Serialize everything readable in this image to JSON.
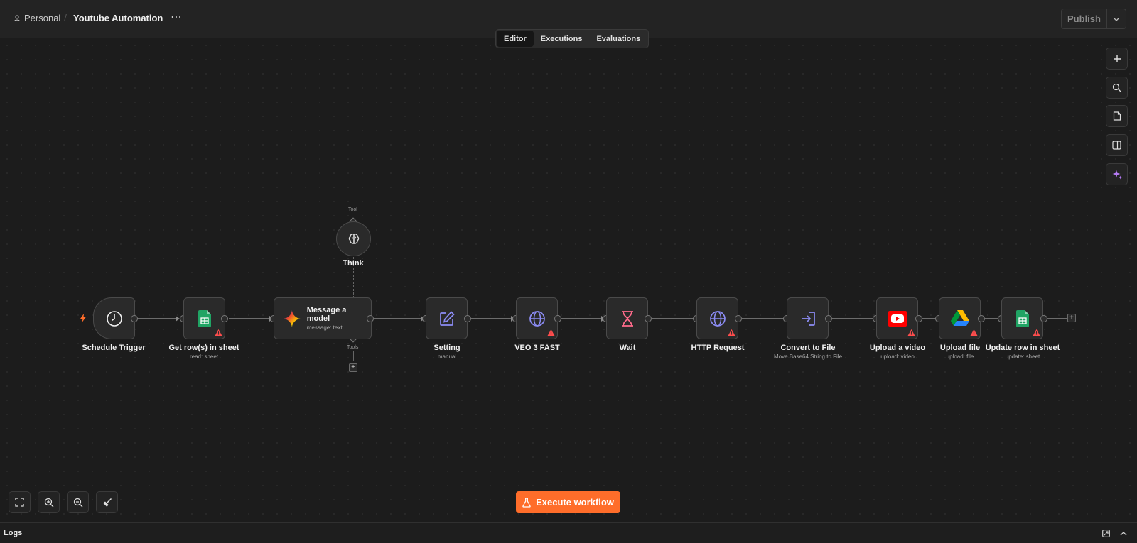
{
  "header": {
    "workspace": "Personal",
    "workflow_title": "Youtube Automation",
    "more": "⋯",
    "publish_label": "Publish"
  },
  "tabs": [
    {
      "label": "Editor",
      "active": true
    },
    {
      "label": "Executions",
      "active": false
    },
    {
      "label": "Evaluations",
      "active": false
    }
  ],
  "nodes": {
    "schedule": {
      "label": "Schedule Trigger",
      "icon": "clock-icon"
    },
    "getrows": {
      "label": "Get row(s) in sheet",
      "sub": "read: sheet",
      "icon": "google-sheets-icon",
      "warning": true
    },
    "message": {
      "label": "Message a model",
      "sub": "message: text",
      "icon": "gemini-icon"
    },
    "think": {
      "label": "Think",
      "icon": "brain-icon",
      "port_top": "Tool"
    },
    "tools_port": "Tools",
    "setting": {
      "label": "Setting",
      "sub": "manual",
      "icon": "edit-icon"
    },
    "veo": {
      "label": "VEO 3 FAST",
      "icon": "globe-icon",
      "warning": true
    },
    "wait": {
      "label": "Wait",
      "icon": "hourglass-icon"
    },
    "http": {
      "label": "HTTP Request",
      "icon": "globe-icon",
      "warning": true
    },
    "convert": {
      "label": "Convert to File",
      "sub": "Move Base64 String to File",
      "icon": "file-import-icon"
    },
    "upload_video": {
      "label": "Upload a video",
      "sub": "upload: video",
      "icon": "youtube-icon",
      "warning": true
    },
    "upload_file": {
      "label": "Upload file",
      "sub": "upload: file",
      "icon": "google-drive-icon",
      "warning": true
    },
    "update_row": {
      "label": "Update row in sheet",
      "sub": "update: sheet",
      "icon": "google-sheets-icon",
      "warning": true
    }
  },
  "actions": {
    "execute_label": "Execute workflow"
  },
  "logs": {
    "label": "Logs"
  },
  "colors": {
    "accent": "#ff6d2a",
    "warning": "#ff4d4d",
    "icon_purple": "#8c8cf5",
    "icon_pink": "#ff6b8b"
  }
}
